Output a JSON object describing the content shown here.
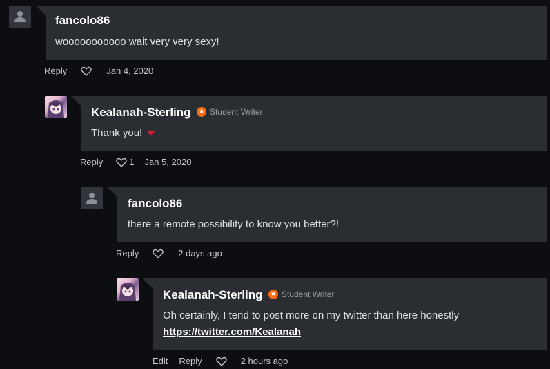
{
  "comments": [
    {
      "username": "fancolo86",
      "text": "wooooooooooo wait very very sexy!",
      "reply_label": "Reply",
      "likes": "",
      "date": "Jan 4, 2020"
    },
    {
      "username": "Kealanah-Sterling",
      "badge": "Student Writer",
      "text": "Thank you!",
      "reply_label": "Reply",
      "likes": "1",
      "date": "Jan 5, 2020"
    },
    {
      "username": "fancolo86",
      "text": "there a remote possibility to know you better?!",
      "reply_label": "Reply",
      "likes": "",
      "date": "2 days ago"
    },
    {
      "username": "Kealanah-Sterling",
      "badge": "Student Writer",
      "text": "Oh certainly, I tend to post more on my twitter than here honestly",
      "link": "https://twitter.com/Kealanah",
      "edit_label": "Edit",
      "reply_label": "Reply",
      "likes": "",
      "date": "2 hours ago"
    }
  ],
  "colors": {
    "badge": "#ff6a10",
    "heart_emoji": "#d91e2e",
    "bubble": "#2a2d32"
  }
}
